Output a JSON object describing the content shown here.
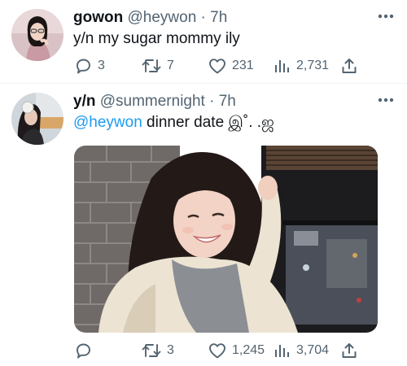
{
  "tweets": [
    {
      "display_name": "gowon",
      "handle": "@heywon",
      "separator": "·",
      "time": "7h",
      "text": "y/n my sugar mommy ily",
      "mention": "",
      "actions": {
        "replies": "3",
        "retweets": "7",
        "likes": "231",
        "views": "2,731"
      }
    },
    {
      "display_name": "y/n",
      "handle": "@summernight",
      "separator": "·",
      "time": "7h",
      "mention": "@heywon",
      "text": " dinner date இ˚. .ஜ",
      "actions": {
        "replies": "",
        "retweets": "3",
        "likes": "1,245",
        "views": "3,704"
      }
    }
  ],
  "icons": {
    "reply": "reply-icon",
    "retweet": "retweet-icon",
    "like": "heart-icon",
    "views": "views-bar-chart-icon",
    "share": "share-icon",
    "more": "more-dots-icon"
  },
  "colors": {
    "text_primary": "#0f1419",
    "text_secondary": "#536471",
    "accent": "#1d9bf0",
    "divider": "#eff3f4"
  }
}
